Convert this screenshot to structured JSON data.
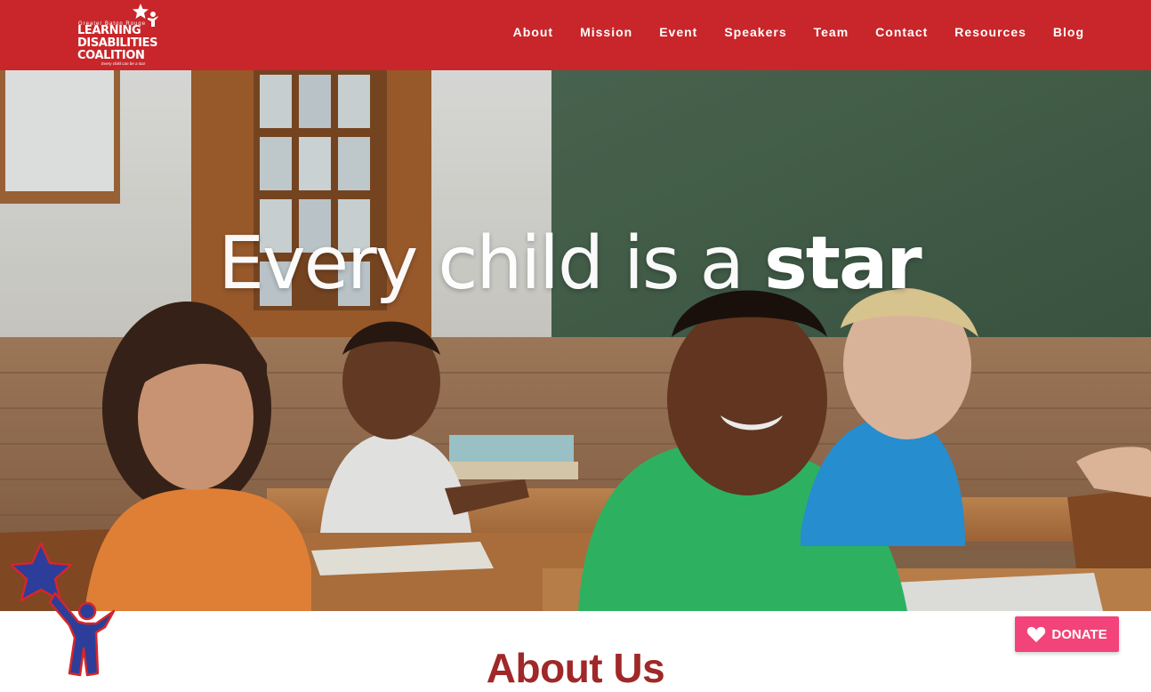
{
  "brand": {
    "top_line": "Greater Baton Rouge",
    "line1": "LEARNING",
    "line2": "DISABILITIES",
    "line3": "COALITION",
    "tagline": "Every child can be a star"
  },
  "nav": {
    "items": [
      "About",
      "Mission",
      "Event",
      "Speakers",
      "Team",
      "Contact",
      "Resources",
      "Blog"
    ]
  },
  "hero": {
    "title_light": "Every child is a ",
    "title_bold": "star"
  },
  "about": {
    "title": "About Us"
  },
  "donate": {
    "label": "DONATE",
    "icon": "heart-icon"
  },
  "colors": {
    "header": "#c8262a",
    "about_title": "#a02828",
    "donate": "#f2447a",
    "mascot_star": "#2c3e99",
    "mascot_outline": "#d6262a"
  }
}
